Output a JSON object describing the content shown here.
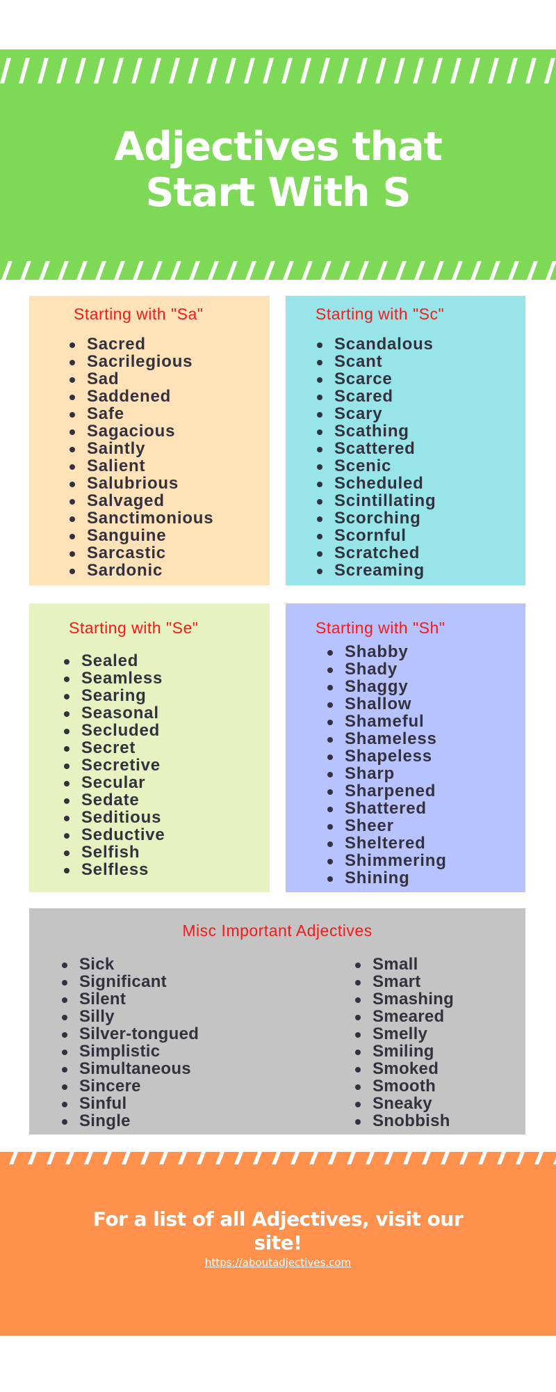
{
  "header": {
    "title_line1": "Adjectives that",
    "title_line2": "Start With S",
    "background_color": "#7ed957"
  },
  "sections": {
    "sa": {
      "title": "Starting with \"Sa\"",
      "background_color": "#ffe2b8",
      "items": [
        "Sacred",
        "Sacrilegious",
        "Sad",
        "Saddened",
        "Safe",
        "Sagacious",
        "Saintly",
        "Salient",
        "Salubrious",
        "Salvaged",
        "Sanctimonious",
        "Sanguine",
        "Sarcastic",
        "Sardonic"
      ]
    },
    "sc": {
      "title": "Starting with \"Sc\"",
      "background_color": "#97e5e8",
      "items": [
        "Scandalous",
        "Scant",
        "Scarce",
        "Scared",
        "Scary",
        "Scathing",
        "Scattered",
        "Scenic",
        "Scheduled",
        "Scintillating",
        "Scorching",
        "Scornful",
        "Scratched",
        "Screaming"
      ]
    },
    "se": {
      "title": "Starting with \"Se\"",
      "background_color": "#e7f2c1",
      "items": [
        "Sealed",
        "Seamless",
        "Searing",
        "Seasonal",
        "Secluded",
        "Secret",
        "Secretive",
        "Secular",
        "Sedate",
        "Seditious",
        "Seductive",
        "Selfish",
        "Selfless"
      ]
    },
    "sh": {
      "title": "Starting with \"Sh\"",
      "background_color": "#b7c3ff",
      "items": [
        "Shabby",
        "Shady",
        "Shaggy",
        "Shallow",
        "Shameful",
        "Shameless",
        "Shapeless",
        "Sharp",
        "Sharpened",
        "Shattered",
        "Sheer",
        "Sheltered",
        "Shimmering",
        "Shining"
      ]
    },
    "misc": {
      "title": "Misc Important Adjectives",
      "background_color": "#c4c4c4",
      "items_left": [
        "Sick",
        "Significant",
        "Silent",
        "Silly",
        "Silver-tongued",
        "Simplistic",
        "Simultaneous",
        "Sincere",
        "Sinful",
        "Single"
      ],
      "items_right": [
        "Small",
        "Smart",
        "Smashing",
        "Smeared",
        "Smelly",
        "Smiling",
        "Smoked",
        "Smooth",
        "Sneaky",
        "Snobbish"
      ]
    }
  },
  "footer": {
    "title": "For a list of all Adjectives, visit our site!",
    "link": "https://aboutadjectives.com",
    "background_color": "#ff914d"
  },
  "colors": {
    "section_title": "#ff1616",
    "list_text": "#34313f"
  }
}
